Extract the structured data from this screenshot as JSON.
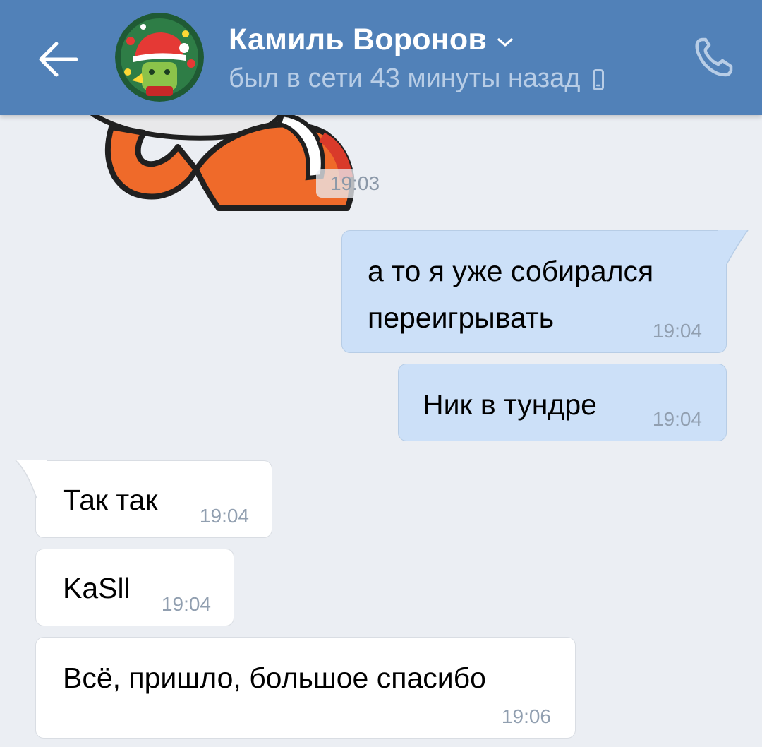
{
  "header": {
    "contact_name": "Камиль Воронов",
    "status": "был в сети 43 минуты назад",
    "back_icon": "arrow-left-icon",
    "dropdown_icon": "chevron-down-icon",
    "device_icon": "mobile-phone-icon",
    "call_icon": "phone-icon",
    "background_color": "#5181b8"
  },
  "sticker": {
    "time": "19:03"
  },
  "messages": [
    {
      "direction": "out",
      "lines": [
        "а то я уже собирался",
        "переигрывать"
      ],
      "time": "19:04"
    },
    {
      "direction": "out",
      "lines": [
        "Ник в тундре"
      ],
      "time": "19:04"
    },
    {
      "direction": "in",
      "lines": [
        "Так так"
      ],
      "time": "19:04"
    },
    {
      "direction": "in",
      "lines": [
        "KaSll"
      ],
      "time": "19:04"
    },
    {
      "direction": "in",
      "lines": [
        "Всё, пришло, большое спасибо"
      ],
      "time": "19:06"
    }
  ],
  "colors": {
    "outgoing_bubble": "#cce0f8",
    "incoming_bubble": "#ffffff",
    "chat_background": "#ebeef3"
  }
}
